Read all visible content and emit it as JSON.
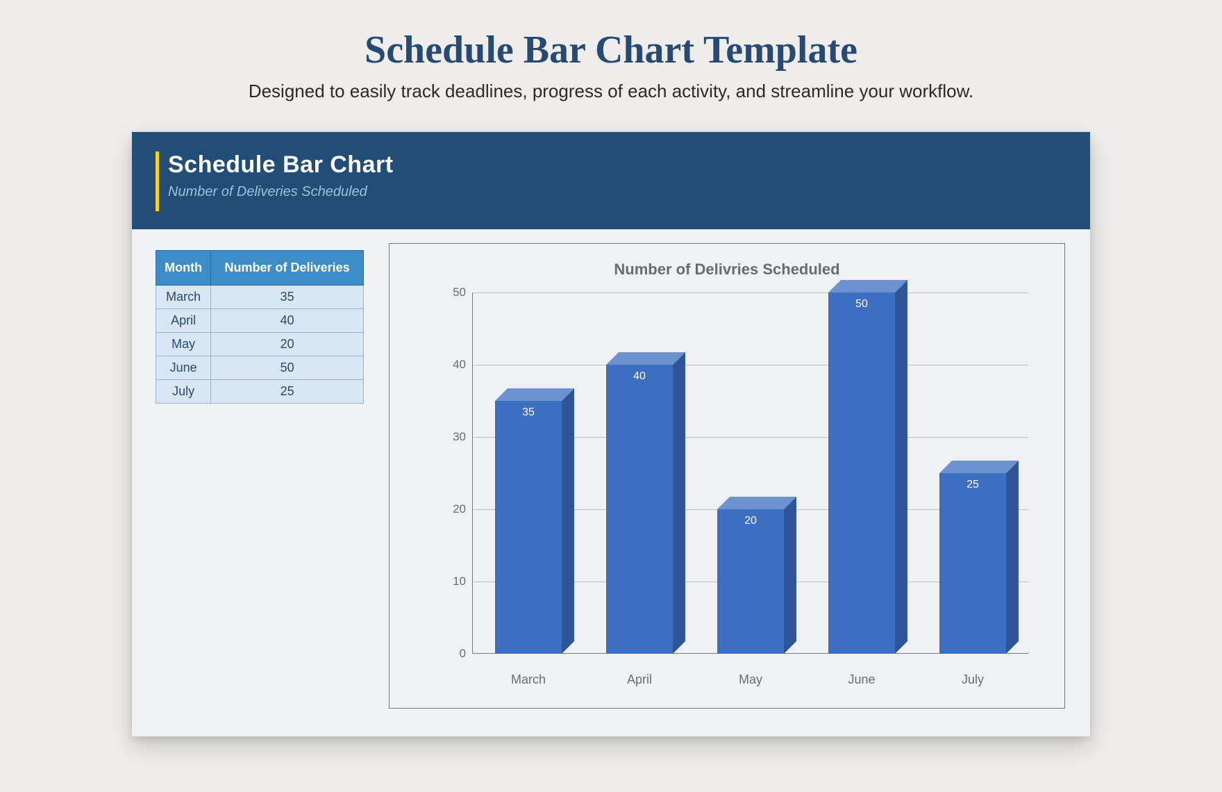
{
  "page": {
    "title": "Schedule Bar Chart Template",
    "subtitle": "Designed to easily track deadlines, progress of each activity, and streamline your workflow."
  },
  "card": {
    "title": "Schedule Bar Chart",
    "subtitle": "Number of Deliveries Scheduled"
  },
  "table": {
    "headers": {
      "month": "Month",
      "value": "Number of Deliveries"
    },
    "rows": [
      {
        "month": "March",
        "value": 35
      },
      {
        "month": "April",
        "value": 40
      },
      {
        "month": "May",
        "value": 20
      },
      {
        "month": "June",
        "value": 50
      },
      {
        "month": "July",
        "value": 25
      }
    ]
  },
  "chart_data": {
    "type": "bar",
    "title": "Number of Delivries Scheduled",
    "xlabel": "",
    "ylabel": "",
    "categories": [
      "March",
      "April",
      "May",
      "June",
      "July"
    ],
    "values": [
      35,
      40,
      20,
      50,
      25
    ],
    "ylim": [
      0,
      50
    ],
    "yticks": [
      0,
      10,
      20,
      30,
      40,
      50
    ],
    "grid": true,
    "legend": false
  },
  "colors": {
    "header_bg": "#214d76",
    "accent": "#ffd21f",
    "bar_front": "#3c6fc0",
    "bar_top": "#6d92d2",
    "bar_side": "#2e549a",
    "table_header": "#3c8cc8",
    "table_cell": "#d6e6f4"
  }
}
